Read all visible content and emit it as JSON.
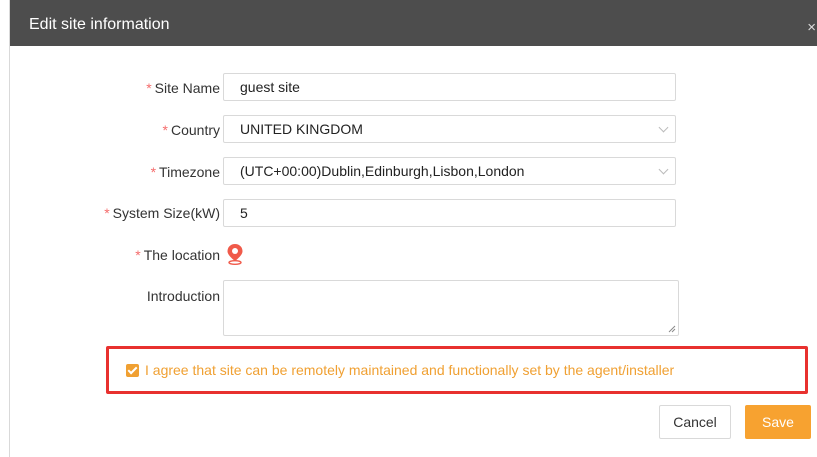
{
  "dialog": {
    "title": "Edit site information",
    "close_symbol": "×"
  },
  "form": {
    "required_mark": "*",
    "site_name": {
      "label": "Site Name",
      "value": "guest site"
    },
    "country": {
      "label": "Country",
      "value": "UNITED KINGDOM"
    },
    "timezone": {
      "label": "Timezone",
      "value": "(UTC+00:00)Dublin,Edinburgh,Lisbon,London"
    },
    "system_size": {
      "label": "System Size(kW)",
      "value": "5"
    },
    "location": {
      "label": "The location",
      "icon": "map-pin-icon"
    },
    "introduction": {
      "label": "Introduction",
      "value": ""
    }
  },
  "agreement": {
    "checked": true,
    "text": "I agree that site can be remotely maintained and functionally set by the agent/installer"
  },
  "buttons": {
    "cancel": "Cancel",
    "save": "Save"
  },
  "colors": {
    "header_bg": "#4d4d4d",
    "accent": "#f7a230",
    "required": "#f56c6c",
    "highlight_border": "#e8312f",
    "location_icon": "#f05a4a"
  }
}
